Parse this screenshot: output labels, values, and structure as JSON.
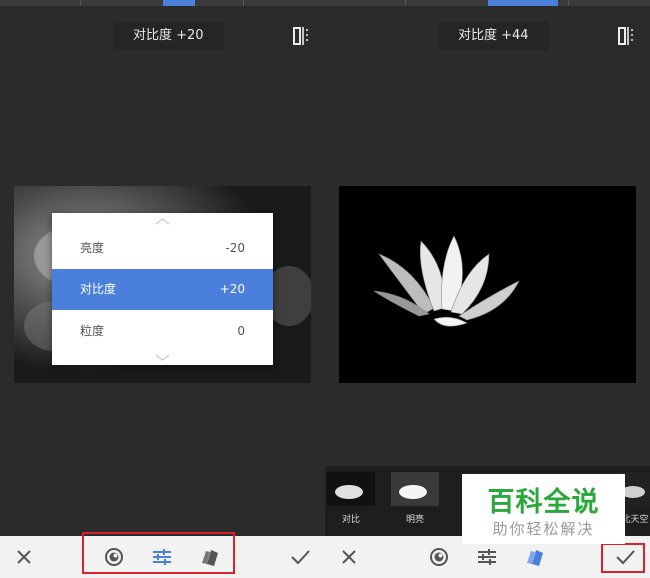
{
  "left_panel": {
    "adjustment_chip": "对比度 +20",
    "menu": {
      "items": [
        {
          "label": "亮度",
          "value": "-20"
        },
        {
          "label": "对比度",
          "value": "+20"
        },
        {
          "label": "粒度",
          "value": "0"
        }
      ],
      "selected_index": 1
    }
  },
  "right_panel": {
    "adjustment_chip": "对比度 +44",
    "styles": [
      {
        "label": "对比"
      },
      {
        "label": "明亮"
      },
      {
        "label": "北天空"
      }
    ]
  },
  "bottom_icons": [
    "close-icon",
    "preset-icon",
    "tune-icon",
    "styles-icon",
    "check-icon"
  ],
  "watermark": {
    "title": "百科全说",
    "subtitle": "助你轻松解决"
  },
  "colors": {
    "accent": "#4a7fdc",
    "highlight_box": "#d9232c",
    "watermark_green": "#2aa83b"
  }
}
